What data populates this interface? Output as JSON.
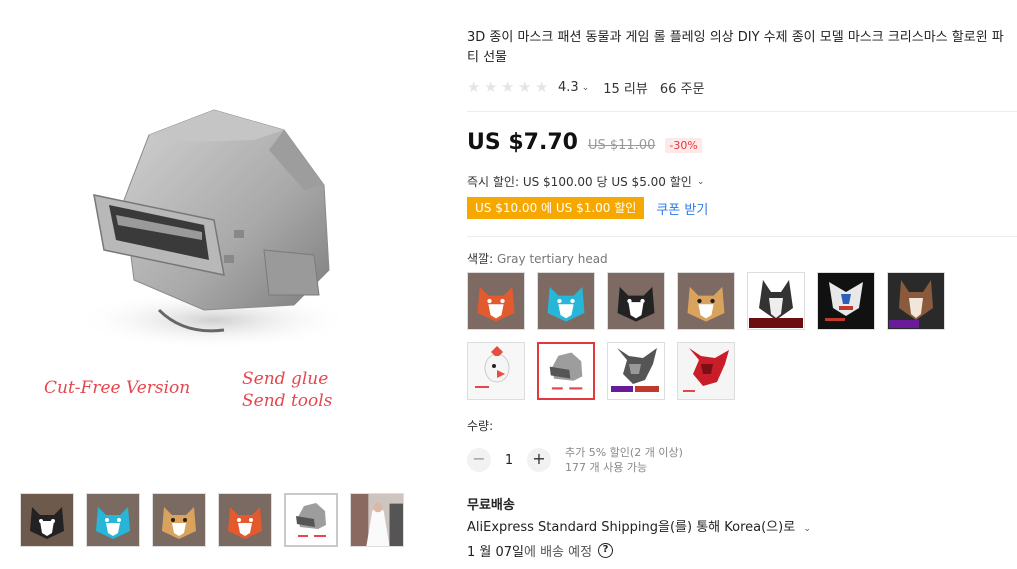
{
  "gallery": {
    "caption_left": "Cut-Free Version",
    "caption_right_1": "Send glue",
    "caption_right_2": "Send tools",
    "thumbs": [
      "black-white-cat",
      "blue-cat",
      "orange-cat",
      "red-cat",
      "gray-helmet",
      "wedding-photo"
    ],
    "active_thumb": 4
  },
  "product": {
    "title": "3D 종이 마스크 패션 동물과 게임 롤 플레잉 의상 DIY 수제 종이 모델 마스크 크리스마스 할로윈 파티 선물",
    "rating": "4.3",
    "reviews": "15 리뷰",
    "orders": "66 주문",
    "price": "US $7.70",
    "old_price": "US $11.00",
    "discount": "-30%",
    "instant_discount": "즉시 할인: US $100.00 당 US $5.00 할인",
    "promo_badge": "US $10.00 에 US $1.00 할인",
    "coupon_link": "쿠폰 받기",
    "color_label": "색깔:",
    "color_value": "Gray tertiary head",
    "swatches": [
      "red-cat",
      "blue-cat",
      "black-cat",
      "orange-cat",
      "husky",
      "robot",
      "wolf",
      "bird",
      "gray-helmet",
      "dragon-gray",
      "dragon-red"
    ],
    "selected_swatch": 8,
    "qty_label": "수량:",
    "qty_value": "1",
    "qty_note_1": "추가 5% 할인(2 개 이상)",
    "qty_note_2": "177 개 사용 가능",
    "ship_title": "무료배송",
    "ship_method": "AliExpress Standard Shipping을(를) 통해 Korea(으)로",
    "ship_date_bold": "1 월 07일",
    "ship_date_rest": "에 배송 예정"
  },
  "colors": {
    "accent_red": "#e4393c",
    "promo_orange": "#f7a800",
    "link_blue": "#2f7ae5",
    "caption_red": "#e4474e"
  }
}
